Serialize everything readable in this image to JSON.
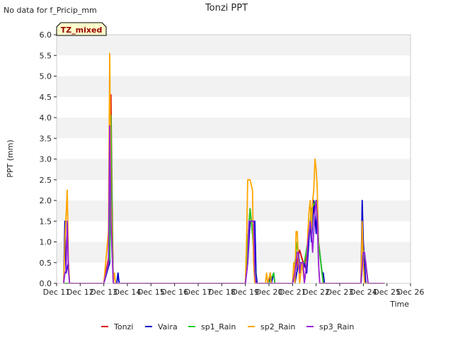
{
  "page": {
    "note": "No data for f_Pricip_mm",
    "badge": "TZ_mixed"
  },
  "chart_data": {
    "type": "line",
    "title": "Tonzi PPT",
    "xlabel": "Time",
    "ylabel": "PPT (mm)",
    "xlim": [
      11,
      26
    ],
    "ylim": [
      0,
      6
    ],
    "x_ticks": [
      11,
      12,
      13,
      14,
      15,
      16,
      17,
      18,
      19,
      20,
      21,
      22,
      23,
      24,
      25,
      26
    ],
    "x_tick_labels": [
      "Dec 11",
      "Dec 12",
      "Dec 13",
      "Dec 14",
      "Dec 15",
      "Dec 16",
      "Dec 17",
      "Dec 18",
      "Dec 19",
      "Dec 20",
      "Dec 21",
      "Dec 22",
      "Dec 23",
      "Dec 24",
      "Dec 25",
      "Dec 26"
    ],
    "y_ticks": [
      0,
      0.5,
      1,
      1.5,
      2,
      2.5,
      3,
      3.5,
      4,
      4.5,
      5,
      5.5,
      6
    ],
    "y_tick_labels": [
      "0.0",
      "0.5",
      "1.0",
      "1.5",
      "2.0",
      "2.5",
      "3.0",
      "3.5",
      "4.0",
      "4.5",
      "5.0",
      "5.5",
      "6.0"
    ],
    "grid": false,
    "background_bands": true,
    "legend_position": "bottom",
    "series": [
      {
        "name": "Tonzi",
        "color": "#dd0000",
        "points": [
          [
            11.3,
            0
          ],
          [
            13.0,
            0
          ],
          [
            13.2,
            0.6
          ],
          [
            13.3,
            4.55
          ],
          [
            13.35,
            2.0
          ],
          [
            13.4,
            0
          ],
          [
            19.0,
            0
          ],
          [
            19.1,
            1.0
          ],
          [
            19.2,
            1.8
          ],
          [
            19.3,
            1.2
          ],
          [
            19.45,
            0
          ],
          [
            20.0,
            0
          ],
          [
            20.05,
            0.25
          ],
          [
            20.1,
            0
          ],
          [
            21.0,
            0
          ],
          [
            21.3,
            0.8
          ],
          [
            21.5,
            0.4
          ],
          [
            21.8,
            1.5
          ],
          [
            22.0,
            2.0
          ],
          [
            22.1,
            1.0
          ],
          [
            22.3,
            0
          ],
          [
            23.9,
            0
          ],
          [
            24.0,
            0.8
          ],
          [
            24.1,
            0.5
          ],
          [
            24.2,
            0
          ],
          [
            24.9,
            0
          ]
        ]
      },
      {
        "name": "Vaira",
        "color": "#0000cc",
        "points": [
          [
            11.3,
            0
          ],
          [
            11.35,
            1.5
          ],
          [
            11.4,
            0.25
          ],
          [
            11.5,
            0.5
          ],
          [
            11.55,
            0
          ],
          [
            13.0,
            0
          ],
          [
            13.25,
            0.5
          ],
          [
            13.3,
            3.8
          ],
          [
            13.35,
            1.5
          ],
          [
            13.4,
            0
          ],
          [
            13.55,
            0
          ],
          [
            13.6,
            0.25
          ],
          [
            13.65,
            0
          ],
          [
            19.0,
            0
          ],
          [
            19.1,
            0.5
          ],
          [
            19.2,
            1.5
          ],
          [
            19.3,
            1.5
          ],
          [
            19.4,
            1.5
          ],
          [
            19.45,
            0.25
          ],
          [
            19.5,
            0
          ],
          [
            20.0,
            0
          ],
          [
            20.05,
            0.25
          ],
          [
            20.1,
            0
          ],
          [
            20.2,
            0.25
          ],
          [
            20.25,
            0
          ],
          [
            21.0,
            0
          ],
          [
            21.05,
            0.25
          ],
          [
            21.1,
            0
          ],
          [
            21.25,
            0.5
          ],
          [
            21.3,
            0.25
          ],
          [
            21.5,
            0.5
          ],
          [
            21.6,
            0.25
          ],
          [
            21.75,
            1.5
          ],
          [
            21.8,
            1.0
          ],
          [
            21.9,
            2.0
          ],
          [
            22.0,
            1.2
          ],
          [
            22.05,
            2.0
          ],
          [
            22.1,
            1.0
          ],
          [
            22.25,
            0.25
          ],
          [
            22.3,
            0.25
          ],
          [
            22.35,
            0
          ],
          [
            23.9,
            0
          ],
          [
            23.95,
            2.0
          ],
          [
            24.0,
            1.0
          ],
          [
            24.05,
            0.5
          ],
          [
            24.1,
            0
          ],
          [
            24.9,
            0
          ]
        ]
      },
      {
        "name": "sp1_Rain",
        "color": "#22cc22",
        "points": [
          [
            11.3,
            0
          ],
          [
            13.0,
            0
          ],
          [
            13.25,
            0.6
          ],
          [
            13.3,
            4.05
          ],
          [
            13.35,
            1.5
          ],
          [
            13.4,
            0
          ],
          [
            19.0,
            0
          ],
          [
            19.1,
            1.0
          ],
          [
            19.2,
            1.8
          ],
          [
            19.3,
            1.2
          ],
          [
            19.45,
            0
          ],
          [
            20.0,
            0
          ],
          [
            20.2,
            0.25
          ],
          [
            20.25,
            0
          ],
          [
            21.0,
            0
          ],
          [
            21.1,
            0.5
          ],
          [
            21.2,
            1.0
          ],
          [
            21.3,
            0.5
          ],
          [
            21.5,
            0.5
          ],
          [
            21.7,
            1.2
          ],
          [
            21.8,
            1.8
          ],
          [
            22.0,
            2.0
          ],
          [
            22.1,
            1.0
          ],
          [
            22.3,
            0
          ],
          [
            23.9,
            0
          ],
          [
            24.0,
            0.8
          ],
          [
            24.1,
            0.5
          ],
          [
            24.2,
            0
          ],
          [
            24.9,
            0
          ]
        ]
      },
      {
        "name": "sp2_Rain",
        "color": "#ffa500",
        "points": [
          [
            11.3,
            0
          ],
          [
            11.35,
            1.0
          ],
          [
            11.45,
            2.25
          ],
          [
            11.5,
            0.5
          ],
          [
            11.55,
            0
          ],
          [
            13.0,
            0
          ],
          [
            13.2,
            1.25
          ],
          [
            13.25,
            5.55
          ],
          [
            13.3,
            2.0
          ],
          [
            13.4,
            0
          ],
          [
            13.45,
            0.25
          ],
          [
            13.5,
            0
          ],
          [
            19.0,
            0
          ],
          [
            19.05,
            1.0
          ],
          [
            19.1,
            2.5
          ],
          [
            19.2,
            2.5
          ],
          [
            19.3,
            2.25
          ],
          [
            19.35,
            0.5
          ],
          [
            19.4,
            0
          ],
          [
            19.85,
            0
          ],
          [
            19.9,
            0.25
          ],
          [
            19.95,
            0
          ],
          [
            20.05,
            0.25
          ],
          [
            20.1,
            0
          ],
          [
            21.0,
            0
          ],
          [
            21.05,
            0.5
          ],
          [
            21.1,
            0
          ],
          [
            21.15,
            1.25
          ],
          [
            21.2,
            1.25
          ],
          [
            21.25,
            0.5
          ],
          [
            21.3,
            0
          ],
          [
            21.4,
            0.5
          ],
          [
            21.5,
            0
          ],
          [
            21.6,
            0.5
          ],
          [
            21.65,
            1.25
          ],
          [
            21.7,
            1.75
          ],
          [
            21.75,
            2.0
          ],
          [
            21.8,
            1.25
          ],
          [
            21.85,
            2.0
          ],
          [
            21.9,
            2.25
          ],
          [
            21.95,
            3.0
          ],
          [
            22.0,
            2.75
          ],
          [
            22.05,
            2.25
          ],
          [
            22.1,
            0.5
          ],
          [
            22.15,
            0
          ],
          [
            23.9,
            0
          ],
          [
            23.95,
            1.5
          ],
          [
            24.0,
            0.5
          ],
          [
            24.05,
            0
          ],
          [
            24.9,
            0
          ]
        ]
      },
      {
        "name": "sp3_Rain",
        "color": "#9922dd",
        "points": [
          [
            11.3,
            0
          ],
          [
            11.35,
            0.25
          ],
          [
            11.4,
            0.3
          ],
          [
            11.45,
            1.5
          ],
          [
            11.5,
            0.3
          ],
          [
            11.55,
            0
          ],
          [
            13.0,
            0
          ],
          [
            13.2,
            0.5
          ],
          [
            13.25,
            3.8
          ],
          [
            13.3,
            1.5
          ],
          [
            13.4,
            0
          ],
          [
            19.0,
            0
          ],
          [
            19.1,
            0.5
          ],
          [
            19.15,
            1.5
          ],
          [
            19.2,
            1.5
          ],
          [
            19.3,
            1.5
          ],
          [
            19.35,
            1.5
          ],
          [
            19.4,
            0.25
          ],
          [
            19.45,
            0
          ],
          [
            21.0,
            0
          ],
          [
            21.1,
            0.25
          ],
          [
            21.2,
            0.75
          ],
          [
            21.25,
            0.75
          ],
          [
            21.3,
            0.25
          ],
          [
            21.35,
            0.5
          ],
          [
            21.45,
            0.5
          ],
          [
            21.5,
            0
          ],
          [
            21.6,
            0.5
          ],
          [
            21.65,
            1.0
          ],
          [
            21.7,
            1.25
          ],
          [
            21.75,
            1.5
          ],
          [
            21.8,
            1.25
          ],
          [
            21.85,
            0.75
          ],
          [
            21.9,
            1.25
          ],
          [
            21.95,
            1.75
          ],
          [
            22.0,
            2.0
          ],
          [
            22.05,
            1.5
          ],
          [
            22.1,
            0.5
          ],
          [
            22.15,
            0
          ],
          [
            23.9,
            0
          ],
          [
            24.0,
            0.75
          ],
          [
            24.05,
            0.75
          ],
          [
            24.1,
            0.5
          ],
          [
            24.15,
            0.25
          ],
          [
            24.2,
            0
          ],
          [
            24.9,
            0
          ]
        ]
      }
    ]
  }
}
